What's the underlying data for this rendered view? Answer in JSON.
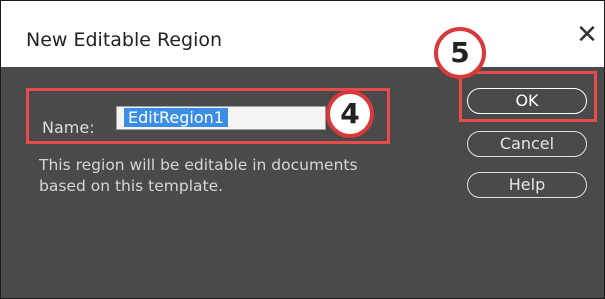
{
  "dialog": {
    "title": "New Editable Region",
    "close_glyph": "✕",
    "name_label": "Name:",
    "name_value": "EditRegion1",
    "helper_text": "This region will be editable in documents based on this template.",
    "buttons": {
      "ok": "OK",
      "cancel": "Cancel",
      "help": "Help"
    }
  },
  "annotations": {
    "step_name": "4",
    "step_ok": "5",
    "highlight_color": "#e74c4c"
  },
  "icons": {
    "close": "close-icon"
  },
  "colors": {
    "dialog_bg": "#4a4a4a",
    "selection": "#3b8ee8"
  }
}
